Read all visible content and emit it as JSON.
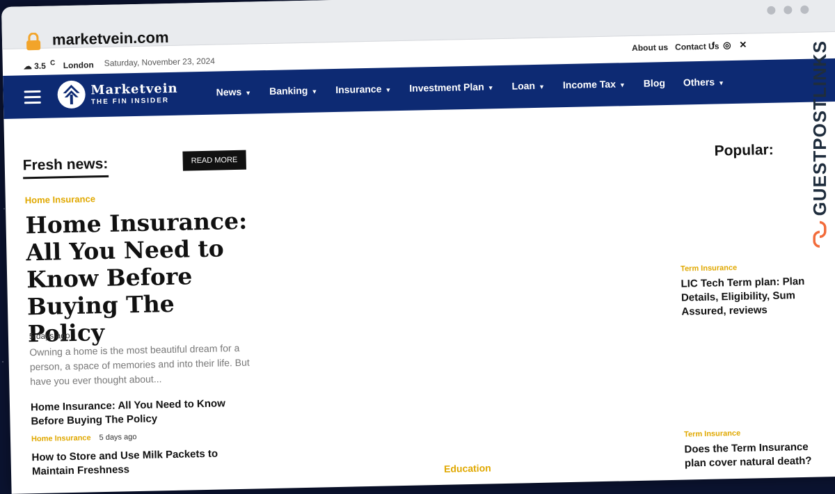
{
  "browser": {
    "url": "marketvein.com"
  },
  "topbar": {
    "temperature": "3.5",
    "unit": "C",
    "city": "London",
    "date": "Saturday, November 23, 2024",
    "links": [
      "About us",
      "Contact Us"
    ],
    "social": [
      "f",
      "ig",
      "x"
    ]
  },
  "brand": {
    "name": "Marketvein",
    "tagline": "THE FIN INSIDER"
  },
  "nav": {
    "items": [
      {
        "label": "News",
        "dropdown": true
      },
      {
        "label": "Banking",
        "dropdown": true
      },
      {
        "label": "Insurance",
        "dropdown": true
      },
      {
        "label": "Investment Plan",
        "dropdown": true
      },
      {
        "label": "Loan",
        "dropdown": true
      },
      {
        "label": "Income Tax",
        "dropdown": true
      },
      {
        "label": "Blog",
        "dropdown": false
      },
      {
        "label": "Others",
        "dropdown": true
      }
    ]
  },
  "fresh": {
    "heading": "Fresh news:",
    "read_more": "READ MORE",
    "featured": {
      "category": "Home Insurance",
      "title": "Home Insurance: All You Need to Know Before Buying The Policy",
      "ago": "5 days ago",
      "excerpt": "Owning a home is the most beautiful dream for a person, a space of memories and into their life. But have you ever thought about..."
    },
    "list": [
      {
        "title": "Home Insurance: All You Need to Know Before Buying The Policy",
        "category": "Home Insurance",
        "ago": "5 days ago"
      },
      {
        "title": "How to Store and Use Milk Packets to Maintain Freshness"
      }
    ]
  },
  "popular": {
    "heading": "Popular:",
    "items": [
      {
        "category": "Term Insurance",
        "title": "LIC Tech Term plan: Plan Details, Eligibility, Sum Assured, reviews"
      },
      {
        "category": "Term Insurance",
        "title": "Does the Term Insurance plan cover natural death?"
      }
    ]
  },
  "middle": {
    "category": "Education"
  },
  "watermark": {
    "text": "GUESTPOSTLINKS"
  },
  "colors": {
    "nav_bg": "#0d2a73",
    "accent": "#e0a800"
  }
}
